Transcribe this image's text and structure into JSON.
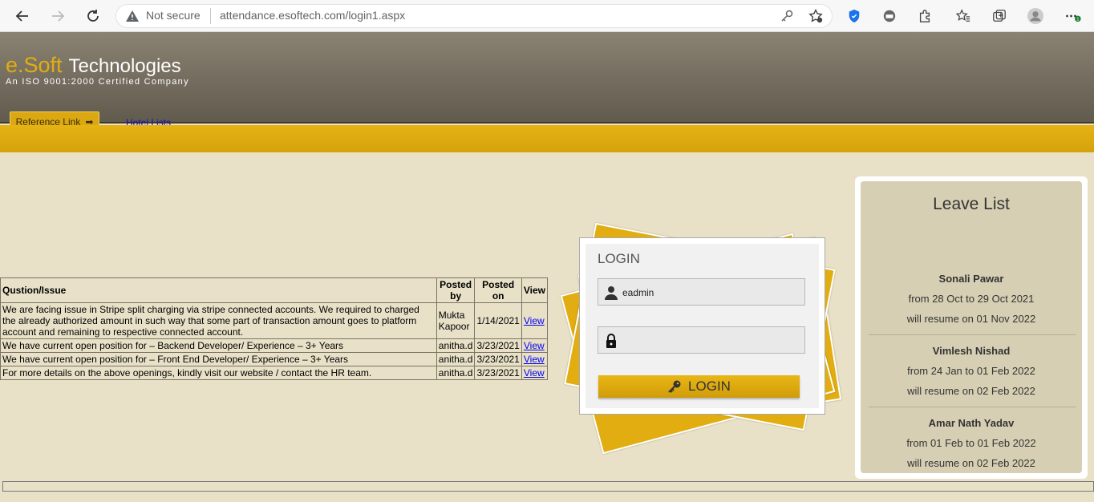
{
  "browser": {
    "not_secure": "Not secure",
    "url": "attendance.esoftech.com/login1.aspx",
    "icons": [
      "back-icon",
      "forward-icon",
      "reload-icon",
      "warning-icon",
      "key-icon",
      "star-add-icon",
      "shield-icon",
      "extension-icon",
      "puzzle-icon",
      "favorites-icon",
      "collections-icon",
      "profile-icon",
      "more-icon"
    ]
  },
  "header": {
    "brand_e": "e.Soft",
    "brand_tech": "Technologies",
    "tagline": "An ISO 9001:2000 Certified Company",
    "reference_link": "Reference Link",
    "hotel_lists": "Hotel Lists"
  },
  "issues": {
    "headers": [
      "Qustion/Issue",
      "Posted by",
      "Posted on",
      "View"
    ],
    "rows": [
      {
        "question": "We are facing issue in Stripe split charging via stripe connected accounts. We required to charged the already authorized amount in such way that some part of transaction amount goes to platform account and remaining to respective connected account.",
        "by": "Mukta Kapoor",
        "on": "1/14/2021",
        "view": "View"
      },
      {
        "question": "We have current open position for – Backend Developer/ Experience – 3+ Years",
        "by": "anitha.d",
        "on": "3/23/2021",
        "view": "View"
      },
      {
        "question": "We have current open position for – Front End Developer/ Experience – 3+ Years",
        "by": "anitha.d",
        "on": "3/23/2021",
        "view": "View"
      },
      {
        "question": "For more details on the above openings, kindly visit our website / contact the HR team.",
        "by": "anitha.d",
        "on": "3/23/2021",
        "view": "View"
      }
    ]
  },
  "login": {
    "title": "LOGIN",
    "username": "eadmin",
    "password": "",
    "button": "LOGIN"
  },
  "leave": {
    "title": "Leave List",
    "entries": [
      {
        "name": "Sonali Pawar",
        "range": "from 28 Oct to 29 Oct 2021",
        "resume": "will resume on 01 Nov 2022"
      },
      {
        "name": "Vimlesh Nishad",
        "range": "from 24 Jan to 01 Feb 2022",
        "resume": "will resume on 02 Feb 2022"
      },
      {
        "name": "Amar Nath Yadav",
        "range": "from 01 Feb to 01 Feb 2022",
        "resume": "will resume on 02 Feb 2022"
      }
    ]
  },
  "colors": {
    "accent_gold": "#e2ad10",
    "header_brown": "#615b4e",
    "page_bg": "#e8e1c8",
    "panel_bg": "#d6cfb4"
  }
}
